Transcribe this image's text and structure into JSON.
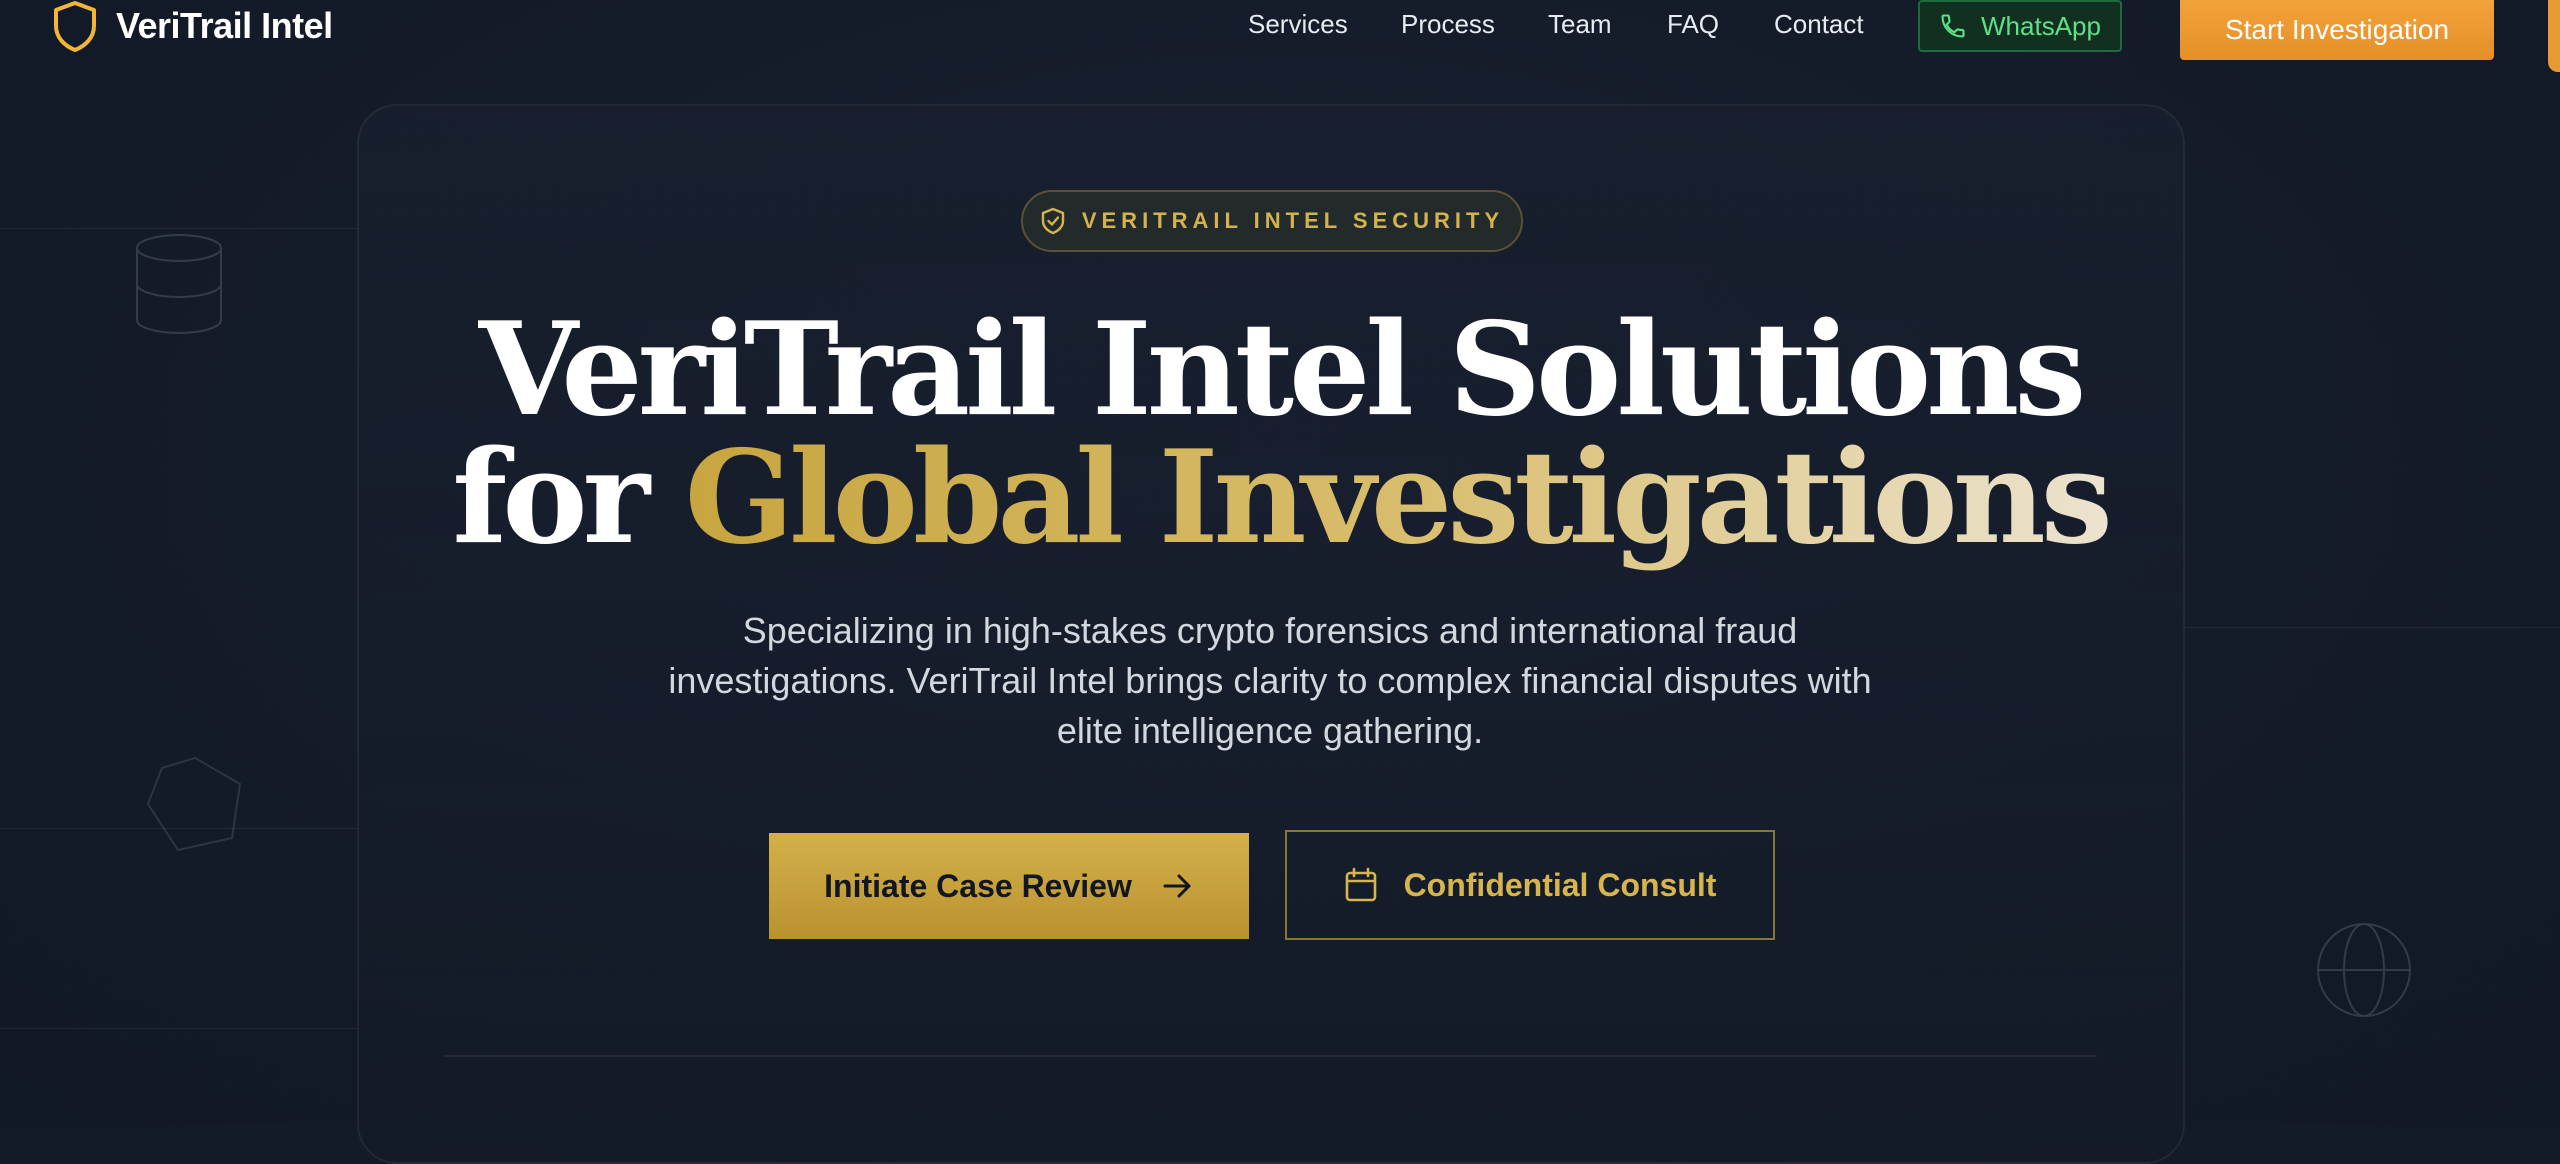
{
  "brand": {
    "name": "VeriTrail Intel",
    "icon": "shield-icon",
    "accent": "#f2b636"
  },
  "nav": {
    "links": [
      "Services",
      "Process",
      "Team",
      "FAQ",
      "Contact"
    ],
    "whatsapp_label": "WhatsApp",
    "whatsapp_icon": "phone-icon",
    "cta_label": "Start Investigation"
  },
  "hero": {
    "badge": {
      "icon": "shield-check-icon",
      "label": "VERITRAIL INTEL SECURITY"
    },
    "headline_line1": "VeriTrail Intel Solutions",
    "headline_line2_prefix": "for ",
    "headline_line2_highlight": "Global Investigations",
    "subtext": "Specializing in high-stakes crypto forensics and international fraud investigations. VeriTrail Intel brings clarity to complex financial disputes with elite intelligence gathering.",
    "primary_cta": {
      "label": "Initiate Case Review",
      "icon": "arrow-right-icon"
    },
    "secondary_cta": {
      "label": "Confidential Consult",
      "icon": "calendar-icon"
    }
  },
  "colors": {
    "background": "#141b29",
    "gold": "#d4b04a",
    "orange": "#e8952e",
    "whatsapp_green": "#5ee08a"
  }
}
